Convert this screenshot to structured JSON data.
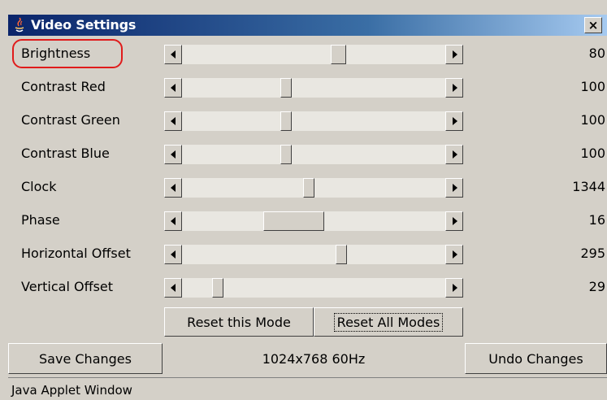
{
  "window": {
    "title": "Video Settings",
    "close_label": "×"
  },
  "sliders": [
    {
      "label": "Brightness",
      "value": "80",
      "position": 0.6,
      "thumb": 0.06,
      "highlighted": true
    },
    {
      "label": "Contrast Red",
      "value": "100",
      "position": 0.39,
      "thumb": 0.04
    },
    {
      "label": "Contrast Green",
      "value": "100",
      "position": 0.39,
      "thumb": 0.04
    },
    {
      "label": "Contrast Blue",
      "value": "100",
      "position": 0.39,
      "thumb": 0.04
    },
    {
      "label": "Clock",
      "value": "1344",
      "position": 0.48,
      "thumb": 0.04
    },
    {
      "label": "Phase",
      "value": "16",
      "position": 0.4,
      "thumb": 0.23
    },
    {
      "label": "Horizontal Offset",
      "value": "295",
      "position": 0.61,
      "thumb": 0.04
    },
    {
      "label": "Vertical Offset",
      "value": "29",
      "position": 0.12,
      "thumb": 0.04
    }
  ],
  "reset_buttons": {
    "reset_this": "Reset this Mode",
    "reset_all": "Reset All Modes"
  },
  "footer": {
    "save": "Save Changes",
    "mode": "1024x768 60Hz",
    "undo": "Undo Changes"
  },
  "status": {
    "text": "Java Applet Window"
  },
  "colors": {
    "highlight": "#e01b1b",
    "titlebar_start": "#0a246a",
    "background": "#d4d0c8"
  }
}
